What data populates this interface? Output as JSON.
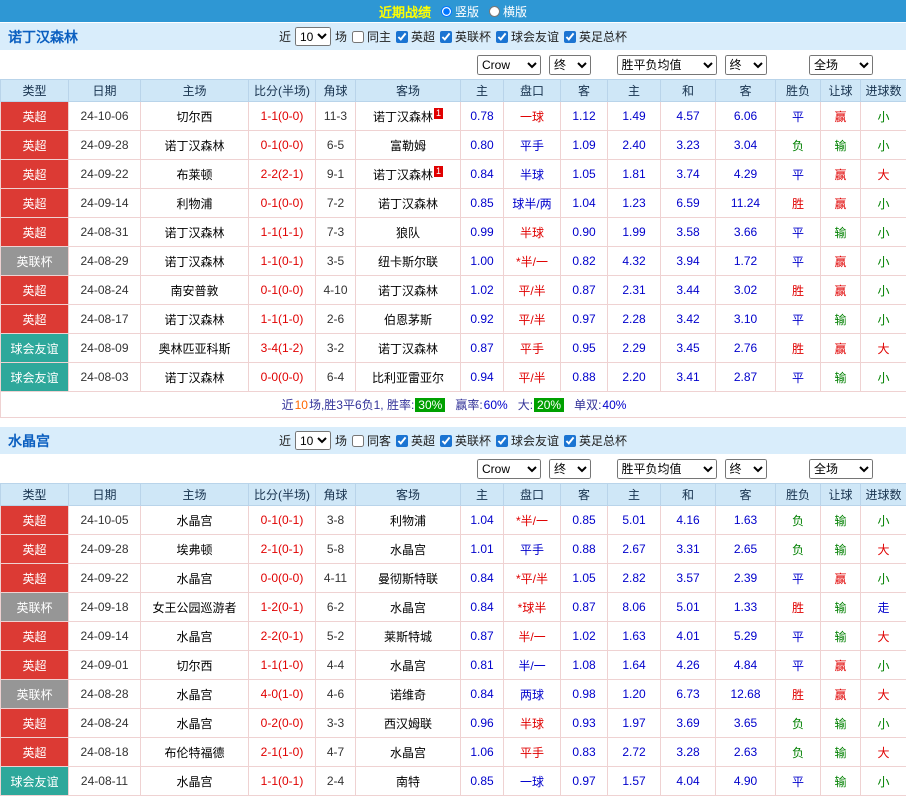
{
  "top_bar": {
    "title": "近期战绩",
    "radio_vertical": "竖版",
    "radio_horizontal": "横版"
  },
  "colors": {
    "topbar_bg": "#2E97D4",
    "title_yellow": "#FFFF00",
    "section_bar_bg": "#D9EDFB",
    "header_row_bg": "#CFE7F7",
    "epl_red": "#DC3A34",
    "league_cup_gray": "#969696",
    "friendly_teal": "#2EA89B",
    "team_green": "#008000",
    "score_red": "#E00000",
    "odds_blue": "#0000CC",
    "rate_badge_green": "#00A000"
  },
  "sections": [
    {
      "team": "诺丁汉森林",
      "filter": {
        "recent_label": "近",
        "count": "10",
        "games_label": "场",
        "same_venue_label": "同主",
        "leagues": [
          "英超",
          "英联杯",
          "球会友谊",
          "英足总杯"
        ]
      },
      "selectors": {
        "odds_source": "Crow",
        "final1": "终",
        "avg": "胜平负均值",
        "final2": "终",
        "scope": "全场"
      },
      "headers": [
        "类型",
        "日期",
        "主场",
        "比分(半场)",
        "角球",
        "客场",
        "主",
        "盘口",
        "客",
        "主",
        "和",
        "客",
        "胜负",
        "让球",
        "进球数"
      ],
      "rows": [
        {
          "type": "英超",
          "type_class": "bg-red",
          "date": "24-10-06",
          "home": "切尔西",
          "home_class": "",
          "score": "1-1(0-0)",
          "corner": "11-3",
          "away": "诺丁汉森林",
          "away_class": "c-green",
          "away_sup": "1",
          "odds_home": "0.78",
          "handicap": "一球",
          "handicap_class": "c-red",
          "odds_away": "1.12",
          "avg_home": "1.49",
          "avg_draw": "4.57",
          "avg_away": "6.06",
          "result": "平",
          "result_class": "c-blue",
          "handicap_result": "赢",
          "handicap_result_class": "c-red",
          "goals": "小",
          "goals_class": "c-green"
        },
        {
          "type": "英超",
          "type_class": "bg-red",
          "date": "24-09-28",
          "home": "诺丁汉森林",
          "home_class": "c-green",
          "score": "0-1(0-0)",
          "corner": "6-5",
          "away": "富勒姆",
          "away_class": "",
          "odds_home": "0.80",
          "handicap": "平手",
          "handicap_class": "c-blue",
          "odds_away": "1.09",
          "avg_home": "2.40",
          "avg_draw": "3.23",
          "avg_away": "3.04",
          "result": "负",
          "result_class": "c-green",
          "handicap_result": "输",
          "handicap_result_class": "c-green",
          "goals": "小",
          "goals_class": "c-green"
        },
        {
          "type": "英超",
          "type_class": "bg-red",
          "date": "24-09-22",
          "home": "布莱顿",
          "home_class": "",
          "score": "2-2(2-1)",
          "corner": "9-1",
          "away": "诺丁汉森林",
          "away_class": "c-green",
          "away_sup": "1",
          "odds_home": "0.84",
          "handicap": "半球",
          "handicap_class": "c-blue",
          "odds_away": "1.05",
          "avg_home": "1.81",
          "avg_draw": "3.74",
          "avg_away": "4.29",
          "result": "平",
          "result_class": "c-blue",
          "handicap_result": "赢",
          "handicap_result_class": "c-red",
          "goals": "大",
          "goals_class": "c-red"
        },
        {
          "type": "英超",
          "type_class": "bg-red",
          "date": "24-09-14",
          "home": "利物浦",
          "home_class": "",
          "score": "0-1(0-0)",
          "corner": "7-2",
          "away": "诺丁汉森林",
          "away_class": "c-green",
          "odds_home": "0.85",
          "handicap": "球半/两",
          "handicap_class": "c-blue",
          "odds_away": "1.04",
          "avg_home": "1.23",
          "avg_draw": "6.59",
          "avg_away": "11.24",
          "result": "胜",
          "result_class": "c-red",
          "handicap_result": "赢",
          "handicap_result_class": "c-red",
          "goals": "小",
          "goals_class": "c-green"
        },
        {
          "type": "英超",
          "type_class": "bg-red",
          "date": "24-08-31",
          "home": "诺丁汉森林",
          "home_class": "c-green",
          "score": "1-1(1-1)",
          "corner": "7-3",
          "away": "狼队",
          "away_class": "",
          "odds_home": "0.99",
          "handicap": "半球",
          "handicap_class": "c-red",
          "odds_away": "0.90",
          "avg_home": "1.99",
          "avg_draw": "3.58",
          "avg_away": "3.66",
          "result": "平",
          "result_class": "c-blue",
          "handicap_result": "输",
          "handicap_result_class": "c-green",
          "goals": "小",
          "goals_class": "c-green"
        },
        {
          "type": "英联杯",
          "type_class": "bg-gray",
          "date": "24-08-29",
          "home": "诺丁汉森林",
          "home_class": "c-green",
          "score": "1-1(0-1)",
          "corner": "3-5",
          "away": "纽卡斯尔联",
          "away_class": "",
          "odds_home": "1.00",
          "handicap": "*半/一",
          "handicap_class": "c-red",
          "odds_away": "0.82",
          "avg_home": "4.32",
          "avg_draw": "3.94",
          "avg_away": "1.72",
          "result": "平",
          "result_class": "c-blue",
          "handicap_result": "赢",
          "handicap_result_class": "c-red",
          "goals": "小",
          "goals_class": "c-green"
        },
        {
          "type": "英超",
          "type_class": "bg-red",
          "date": "24-08-24",
          "home": "南安普敦",
          "home_class": "",
          "score": "0-1(0-0)",
          "corner": "4-10",
          "away": "诺丁汉森林",
          "away_class": "c-green",
          "odds_home": "1.02",
          "handicap": "平/半",
          "handicap_class": "c-red",
          "odds_away": "0.87",
          "avg_home": "2.31",
          "avg_draw": "3.44",
          "avg_away": "3.02",
          "result": "胜",
          "result_class": "c-red",
          "handicap_result": "赢",
          "handicap_result_class": "c-red",
          "goals": "小",
          "goals_class": "c-green"
        },
        {
          "type": "英超",
          "type_class": "bg-red",
          "date": "24-08-17",
          "home": "诺丁汉森林",
          "home_class": "c-green",
          "score": "1-1(1-0)",
          "corner": "2-6",
          "away": "伯恩茅斯",
          "away_class": "",
          "odds_home": "0.92",
          "handicap": "平/半",
          "handicap_class": "c-red",
          "odds_away": "0.97",
          "avg_home": "2.28",
          "avg_draw": "3.42",
          "avg_away": "3.10",
          "result": "平",
          "result_class": "c-blue",
          "handicap_result": "输",
          "handicap_result_class": "c-green",
          "goals": "小",
          "goals_class": "c-green"
        },
        {
          "type": "球会友谊",
          "type_class": "bg-teal",
          "date": "24-08-09",
          "home": "奥林匹亚科斯",
          "home_class": "",
          "score": "3-4(1-2)",
          "corner": "3-2",
          "away": "诺丁汉森林",
          "away_class": "c-green",
          "odds_home": "0.87",
          "handicap": "平手",
          "handicap_class": "c-red",
          "odds_away": "0.95",
          "avg_home": "2.29",
          "avg_draw": "3.45",
          "avg_away": "2.76",
          "result": "胜",
          "result_class": "c-red",
          "handicap_result": "赢",
          "handicap_result_class": "c-red",
          "goals": "大",
          "goals_class": "c-red"
        },
        {
          "type": "球会友谊",
          "type_class": "bg-teal",
          "date": "24-08-03",
          "home": "诺丁汉森林",
          "home_class": "c-green",
          "score": "0-0(0-0)",
          "corner": "6-4",
          "away": "比利亚雷亚尔",
          "away_class": "",
          "odds_home": "0.94",
          "handicap": "平/半",
          "handicap_class": "c-red",
          "odds_away": "0.88",
          "avg_home": "2.20",
          "avg_draw": "3.41",
          "avg_away": "2.87",
          "result": "平",
          "result_class": "c-blue",
          "handicap_result": "输",
          "handicap_result_class": "c-green",
          "goals": "小",
          "goals_class": "c-green"
        }
      ],
      "summary": {
        "t1": "近",
        "count": "10",
        "t2": "场,胜3平6负1, 胜率:",
        "win_rate": "30%",
        "t3": "赢率:",
        "handicap_win_rate": "60%",
        "t4": "大:",
        "big_rate": "20%",
        "t5": "单双:",
        "odd_even_rate": "40%"
      }
    },
    {
      "team": "水晶宫",
      "filter": {
        "recent_label": "近",
        "count": "10",
        "games_label": "场",
        "same_venue_label": "同客",
        "leagues": [
          "英超",
          "英联杯",
          "球会友谊",
          "英足总杯"
        ]
      },
      "selectors": {
        "odds_source": "Crow",
        "final1": "终",
        "avg": "胜平负均值",
        "final2": "终",
        "scope": "全场"
      },
      "headers": [
        "类型",
        "日期",
        "主场",
        "比分(半场)",
        "角球",
        "客场",
        "主",
        "盘口",
        "客",
        "主",
        "和",
        "客",
        "胜负",
        "让球",
        "进球数"
      ],
      "rows": [
        {
          "type": "英超",
          "type_class": "bg-red",
          "date": "24-10-05",
          "home": "水晶宫",
          "home_class": "c-green",
          "score": "0-1(0-1)",
          "corner": "3-8",
          "away": "利物浦",
          "away_class": "",
          "odds_home": "1.04",
          "handicap": "*半/一",
          "handicap_class": "c-red",
          "odds_away": "0.85",
          "avg_home": "5.01",
          "avg_draw": "4.16",
          "avg_away": "1.63",
          "result": "负",
          "result_class": "c-green",
          "handicap_result": "输",
          "handicap_result_class": "c-green",
          "goals": "小",
          "goals_class": "c-green"
        },
        {
          "type": "英超",
          "type_class": "bg-red",
          "date": "24-09-28",
          "home": "埃弗顿",
          "home_class": "",
          "score": "2-1(0-1)",
          "corner": "5-8",
          "away": "水晶宫",
          "away_class": "c-green",
          "odds_home": "1.01",
          "handicap": "平手",
          "handicap_class": "c-blue",
          "odds_away": "0.88",
          "avg_home": "2.67",
          "avg_draw": "3.31",
          "avg_away": "2.65",
          "result": "负",
          "result_class": "c-green",
          "handicap_result": "输",
          "handicap_result_class": "c-green",
          "goals": "大",
          "goals_class": "c-red"
        },
        {
          "type": "英超",
          "type_class": "bg-red",
          "date": "24-09-22",
          "home": "水晶宫",
          "home_class": "c-green",
          "score": "0-0(0-0)",
          "corner": "4-11",
          "away": "曼彻斯特联",
          "away_class": "",
          "odds_home": "0.84",
          "handicap": "*平/半",
          "handicap_class": "c-red",
          "odds_away": "1.05",
          "avg_home": "2.82",
          "avg_draw": "3.57",
          "avg_away": "2.39",
          "result": "平",
          "result_class": "c-blue",
          "handicap_result": "赢",
          "handicap_result_class": "c-red",
          "goals": "小",
          "goals_class": "c-green"
        },
        {
          "type": "英联杯",
          "type_class": "bg-gray",
          "date": "24-09-18",
          "home": "女王公园巡游者",
          "home_class": "",
          "score": "1-2(0-1)",
          "corner": "6-2",
          "away": "水晶宫",
          "away_class": "c-green",
          "odds_home": "0.84",
          "handicap": "*球半",
          "handicap_class": "c-red",
          "odds_away": "0.87",
          "avg_home": "8.06",
          "avg_draw": "5.01",
          "avg_away": "1.33",
          "result": "胜",
          "result_class": "c-red",
          "handicap_result": "输",
          "handicap_result_class": "c-green",
          "goals": "走",
          "goals_class": "c-blue"
        },
        {
          "type": "英超",
          "type_class": "bg-red",
          "date": "24-09-14",
          "home": "水晶宫",
          "home_class": "c-green",
          "score": "2-2(0-1)",
          "corner": "5-2",
          "away": "莱斯特城",
          "away_class": "",
          "odds_home": "0.87",
          "handicap": "半/一",
          "handicap_class": "c-red",
          "odds_away": "1.02",
          "avg_home": "1.63",
          "avg_draw": "4.01",
          "avg_away": "5.29",
          "result": "平",
          "result_class": "c-blue",
          "handicap_result": "输",
          "handicap_result_class": "c-green",
          "goals": "大",
          "goals_class": "c-red"
        },
        {
          "type": "英超",
          "type_class": "bg-red",
          "date": "24-09-01",
          "home": "切尔西",
          "home_class": "",
          "score": "1-1(1-0)",
          "corner": "4-4",
          "away": "水晶宫",
          "away_class": "c-green",
          "odds_home": "0.81",
          "handicap": "半/一",
          "handicap_class": "c-blue",
          "odds_away": "1.08",
          "avg_home": "1.64",
          "avg_draw": "4.26",
          "avg_away": "4.84",
          "result": "平",
          "result_class": "c-blue",
          "handicap_result": "赢",
          "handicap_result_class": "c-red",
          "goals": "小",
          "goals_class": "c-green"
        },
        {
          "type": "英联杯",
          "type_class": "bg-gray",
          "date": "24-08-28",
          "home": "水晶宫",
          "home_class": "c-green",
          "score": "4-0(1-0)",
          "corner": "4-6",
          "away": "诺维奇",
          "away_class": "",
          "odds_home": "0.84",
          "handicap": "两球",
          "handicap_class": "c-blue",
          "odds_away": "0.98",
          "avg_home": "1.20",
          "avg_draw": "6.73",
          "avg_away": "12.68",
          "result": "胜",
          "result_class": "c-red",
          "handicap_result": "赢",
          "handicap_result_class": "c-red",
          "goals": "大",
          "goals_class": "c-red"
        },
        {
          "type": "英超",
          "type_class": "bg-red",
          "date": "24-08-24",
          "home": "水晶宫",
          "home_class": "c-green",
          "score": "0-2(0-0)",
          "corner": "3-3",
          "away": "西汉姆联",
          "away_class": "",
          "odds_home": "0.96",
          "handicap": "半球",
          "handicap_class": "c-red",
          "odds_away": "0.93",
          "avg_home": "1.97",
          "avg_draw": "3.69",
          "avg_away": "3.65",
          "result": "负",
          "result_class": "c-green",
          "handicap_result": "输",
          "handicap_result_class": "c-green",
          "goals": "小",
          "goals_class": "c-green"
        },
        {
          "type": "英超",
          "type_class": "bg-red",
          "date": "24-08-18",
          "home": "布伦特福德",
          "home_class": "",
          "score": "2-1(1-0)",
          "corner": "4-7",
          "away": "水晶宫",
          "away_class": "c-green",
          "odds_home": "1.06",
          "handicap": "平手",
          "handicap_class": "c-red",
          "odds_away": "0.83",
          "avg_home": "2.72",
          "avg_draw": "3.28",
          "avg_away": "2.63",
          "result": "负",
          "result_class": "c-green",
          "handicap_result": "输",
          "handicap_result_class": "c-green",
          "goals": "大",
          "goals_class": "c-red"
        },
        {
          "type": "球会友谊",
          "type_class": "bg-teal",
          "date": "24-08-11",
          "home": "水晶宫",
          "home_class": "c-green",
          "score": "1-1(0-1)",
          "corner": "2-4",
          "away": "南特",
          "away_class": "",
          "odds_home": "0.85",
          "handicap": "一球",
          "handicap_class": "c-blue",
          "odds_away": "0.97",
          "avg_home": "1.57",
          "avg_draw": "4.04",
          "avg_away": "4.90",
          "result": "平",
          "result_class": "c-blue",
          "handicap_result": "输",
          "handicap_result_class": "c-green",
          "goals": "小",
          "goals_class": "c-green"
        }
      ]
    }
  ]
}
